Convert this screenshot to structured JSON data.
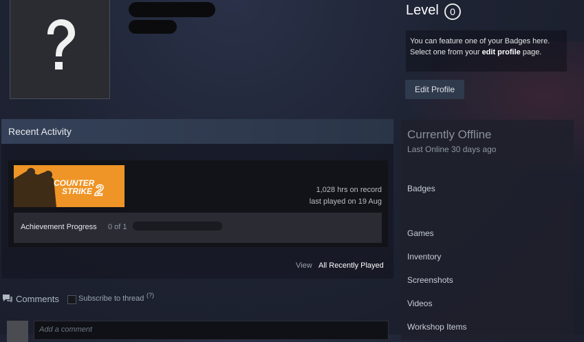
{
  "profile": {
    "level_label": "Level",
    "level_value": "0",
    "badge_text_1": "You can feature one of your Badges here.",
    "badge_text_2a": "Select one from your ",
    "badge_link": "edit profile",
    "badge_text_2b": " page.",
    "edit_button": "Edit Profile"
  },
  "activity": {
    "header": "Recent Activity",
    "game_logo_line1": "COUNTER",
    "game_logo_line2": "STRIKE",
    "game_logo_num": "2",
    "hours": "1,028 hrs on record",
    "last_played": "last played on 19 Aug",
    "achievement_label": "Achievement Progress",
    "achievement_count": "0 of 1",
    "achievement_progress": 0,
    "view_label": "View",
    "view_link": "All Recently Played"
  },
  "comments": {
    "label": "Comments",
    "subscribe": "Subscribe to thread",
    "help": "(?)",
    "placeholder": "Add a comment"
  },
  "sidebar": {
    "status": "Currently Offline",
    "last_online": "Last Online 30 days ago",
    "items": [
      "Badges",
      "Games",
      "Inventory",
      "Screenshots",
      "Videos",
      "Workshop Items"
    ]
  },
  "colors": {
    "accent_orange": "#f5a23a",
    "panel": "#1e2333"
  }
}
